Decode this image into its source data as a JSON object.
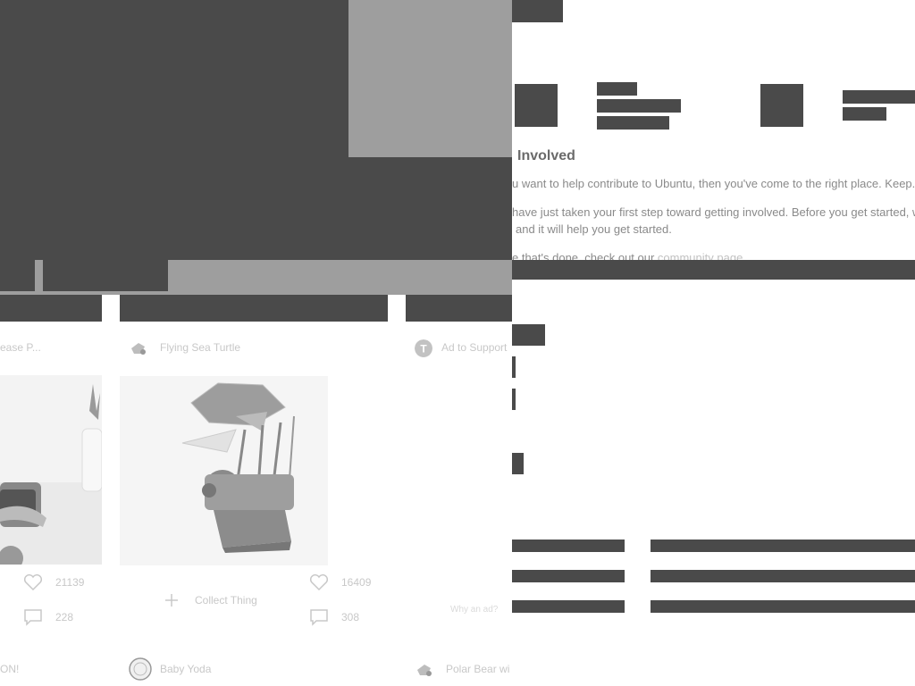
{
  "section": {
    "heading": "Involved",
    "p1": "u want to help contribute to Ubuntu, then you've come to the right place. Keep.",
    "p2a": "have just taken your first step toward getting involved. Before you get started, w",
    "p2b": "and it will help you get started.",
    "p3_prefix": "e that's done, check out our ",
    "p3_link": "community page"
  },
  "cards": [
    {
      "title": "ease P...",
      "likes": "21139",
      "comments": "228",
      "bottom_title": "ON!"
    },
    {
      "title": "Flying Sea Turtle",
      "likes": "16409",
      "comments": "308",
      "collect_label": "Collect Thing",
      "bottom_title": "Baby Yoda"
    },
    {
      "title": "Ad to Support",
      "why_text": "Why an ad?",
      "bottom_title": "Polar Bear wi"
    }
  ],
  "icons": {
    "like": "heart-icon",
    "comment": "comment-icon",
    "add": "plus-icon",
    "sponsor": "t-badge-icon"
  },
  "colors": {
    "block": "#4a4a4a",
    "gray_block": "#9e9e9e",
    "background": "#ffffff"
  }
}
